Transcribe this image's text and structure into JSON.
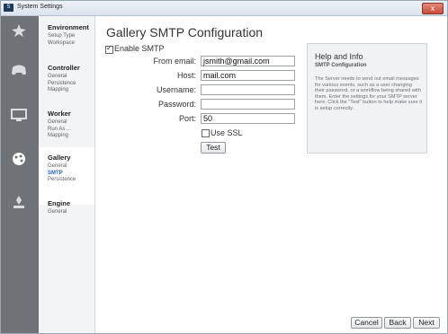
{
  "window": {
    "icon_text": "S",
    "title": "System Settings",
    "close_glyph": "x"
  },
  "sidebar": {
    "sections": [
      {
        "title": "Environment",
        "items": [
          {
            "label": "Setup Type",
            "active": false
          },
          {
            "label": "Workspace",
            "active": false
          }
        ]
      },
      {
        "title": "Controller",
        "items": [
          {
            "label": "General",
            "active": false
          },
          {
            "label": "Persistence",
            "active": false
          },
          {
            "label": "Mapping",
            "active": false
          }
        ]
      },
      {
        "title": "Worker",
        "items": [
          {
            "label": "General",
            "active": false
          },
          {
            "label": "Run As ...",
            "active": false
          },
          {
            "label": "Mapping",
            "active": false
          }
        ]
      },
      {
        "title": "Gallery",
        "items": [
          {
            "label": "General",
            "active": false
          },
          {
            "label": "SMTP",
            "active": true
          },
          {
            "label": "Persistence",
            "active": false
          }
        ]
      },
      {
        "title": "Engine",
        "items": [
          {
            "label": "General",
            "active": false
          }
        ]
      }
    ]
  },
  "main": {
    "title": "Gallery SMTP Configuration",
    "enable_smtp": {
      "label": "Enable SMTP",
      "checked": true
    },
    "fields": {
      "from_email": {
        "label": "From email:",
        "value": "jsmith@gmail.com"
      },
      "host": {
        "label": "Host:",
        "value": "mail.com"
      },
      "username": {
        "label": "Username:",
        "value": ""
      },
      "password": {
        "label": "Password:",
        "value": ""
      },
      "port": {
        "label": "Port:",
        "value": "50"
      }
    },
    "use_ssl": {
      "label": "Use SSL",
      "checked": false
    },
    "test_button": "Test"
  },
  "help": {
    "title": "Help and Info",
    "subtitle": "SMTP Configuration",
    "body": "The Server needs to send out email messages for various events, such as a user changing their password, or a workflow being shared with them. Enter the settings for your SMTP server here. Click the \"Test\" button to help make sure it is setup correctly."
  },
  "footer": {
    "cancel": "Cancel",
    "back": "Back",
    "next": "Next"
  },
  "colors": {
    "accent": "#1f63c2",
    "icon_strip": "#6f7377",
    "close": "#c94b38"
  }
}
